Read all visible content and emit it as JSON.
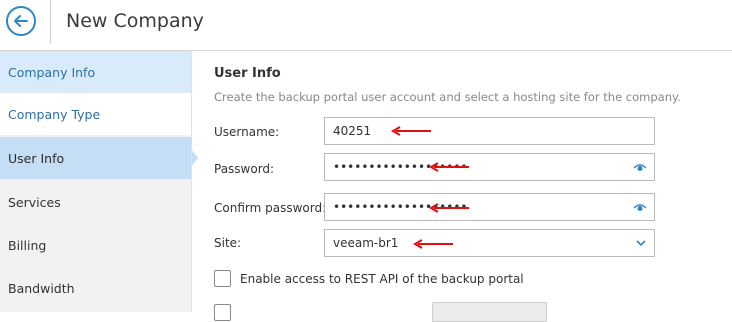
{
  "header": {
    "title": "New Company"
  },
  "sidebar": {
    "items": [
      {
        "label": "Company Info"
      },
      {
        "label": "Company Type"
      },
      {
        "label": "User Info"
      },
      {
        "label": "Services"
      },
      {
        "label": "Billing"
      },
      {
        "label": "Bandwidth"
      }
    ]
  },
  "main": {
    "section_title": "User Info",
    "description": "Create the backup portal user account and select a hosting site for the company.",
    "username": {
      "label": "Username:",
      "value": "40251"
    },
    "password": {
      "label": "Password:",
      "value": "•••••••••••••••••••"
    },
    "confirm_password": {
      "label": "Confirm password:",
      "value": "•••••••••••••••••••"
    },
    "site": {
      "label": "Site:",
      "value": "veeam-br1"
    },
    "rest_api": {
      "label": "Enable access to REST API of the backup portal"
    }
  },
  "colors": {
    "accent": "#2f86c6",
    "annotation_arrow": "#e01010",
    "sidebar_active": "#c4dff5"
  }
}
